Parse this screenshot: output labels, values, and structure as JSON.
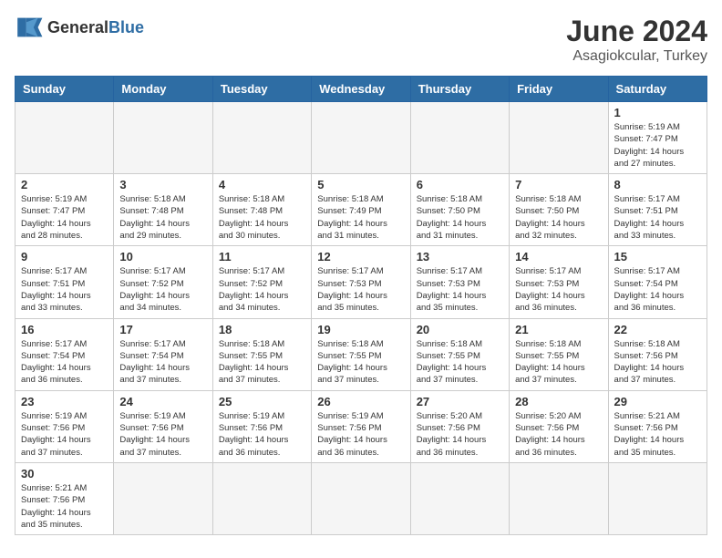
{
  "header": {
    "logo_general": "General",
    "logo_blue": "Blue",
    "month": "June 2024",
    "location": "Asagiokcular, Turkey"
  },
  "days_of_week": [
    "Sunday",
    "Monday",
    "Tuesday",
    "Wednesday",
    "Thursday",
    "Friday",
    "Saturday"
  ],
  "weeks": [
    [
      {
        "day": "",
        "info": ""
      },
      {
        "day": "",
        "info": ""
      },
      {
        "day": "",
        "info": ""
      },
      {
        "day": "",
        "info": ""
      },
      {
        "day": "",
        "info": ""
      },
      {
        "day": "",
        "info": ""
      },
      {
        "day": "1",
        "info": "Sunrise: 5:19 AM\nSunset: 7:47 PM\nDaylight: 14 hours\nand 27 minutes."
      }
    ],
    [
      {
        "day": "2",
        "info": "Sunrise: 5:19 AM\nSunset: 7:47 PM\nDaylight: 14 hours\nand 28 minutes."
      },
      {
        "day": "3",
        "info": "Sunrise: 5:18 AM\nSunset: 7:48 PM\nDaylight: 14 hours\nand 29 minutes."
      },
      {
        "day": "4",
        "info": "Sunrise: 5:18 AM\nSunset: 7:48 PM\nDaylight: 14 hours\nand 30 minutes."
      },
      {
        "day": "5",
        "info": "Sunrise: 5:18 AM\nSunset: 7:49 PM\nDaylight: 14 hours\nand 31 minutes."
      },
      {
        "day": "6",
        "info": "Sunrise: 5:18 AM\nSunset: 7:50 PM\nDaylight: 14 hours\nand 31 minutes."
      },
      {
        "day": "7",
        "info": "Sunrise: 5:18 AM\nSunset: 7:50 PM\nDaylight: 14 hours\nand 32 minutes."
      },
      {
        "day": "8",
        "info": "Sunrise: 5:17 AM\nSunset: 7:51 PM\nDaylight: 14 hours\nand 33 minutes."
      }
    ],
    [
      {
        "day": "9",
        "info": "Sunrise: 5:17 AM\nSunset: 7:51 PM\nDaylight: 14 hours\nand 33 minutes."
      },
      {
        "day": "10",
        "info": "Sunrise: 5:17 AM\nSunset: 7:52 PM\nDaylight: 14 hours\nand 34 minutes."
      },
      {
        "day": "11",
        "info": "Sunrise: 5:17 AM\nSunset: 7:52 PM\nDaylight: 14 hours\nand 34 minutes."
      },
      {
        "day": "12",
        "info": "Sunrise: 5:17 AM\nSunset: 7:53 PM\nDaylight: 14 hours\nand 35 minutes."
      },
      {
        "day": "13",
        "info": "Sunrise: 5:17 AM\nSunset: 7:53 PM\nDaylight: 14 hours\nand 35 minutes."
      },
      {
        "day": "14",
        "info": "Sunrise: 5:17 AM\nSunset: 7:53 PM\nDaylight: 14 hours\nand 36 minutes."
      },
      {
        "day": "15",
        "info": "Sunrise: 5:17 AM\nSunset: 7:54 PM\nDaylight: 14 hours\nand 36 minutes."
      }
    ],
    [
      {
        "day": "16",
        "info": "Sunrise: 5:17 AM\nSunset: 7:54 PM\nDaylight: 14 hours\nand 36 minutes."
      },
      {
        "day": "17",
        "info": "Sunrise: 5:17 AM\nSunset: 7:54 PM\nDaylight: 14 hours\nand 37 minutes."
      },
      {
        "day": "18",
        "info": "Sunrise: 5:18 AM\nSunset: 7:55 PM\nDaylight: 14 hours\nand 37 minutes."
      },
      {
        "day": "19",
        "info": "Sunrise: 5:18 AM\nSunset: 7:55 PM\nDaylight: 14 hours\nand 37 minutes."
      },
      {
        "day": "20",
        "info": "Sunrise: 5:18 AM\nSunset: 7:55 PM\nDaylight: 14 hours\nand 37 minutes."
      },
      {
        "day": "21",
        "info": "Sunrise: 5:18 AM\nSunset: 7:55 PM\nDaylight: 14 hours\nand 37 minutes."
      },
      {
        "day": "22",
        "info": "Sunrise: 5:18 AM\nSunset: 7:56 PM\nDaylight: 14 hours\nand 37 minutes."
      }
    ],
    [
      {
        "day": "23",
        "info": "Sunrise: 5:19 AM\nSunset: 7:56 PM\nDaylight: 14 hours\nand 37 minutes."
      },
      {
        "day": "24",
        "info": "Sunrise: 5:19 AM\nSunset: 7:56 PM\nDaylight: 14 hours\nand 37 minutes."
      },
      {
        "day": "25",
        "info": "Sunrise: 5:19 AM\nSunset: 7:56 PM\nDaylight: 14 hours\nand 36 minutes."
      },
      {
        "day": "26",
        "info": "Sunrise: 5:19 AM\nSunset: 7:56 PM\nDaylight: 14 hours\nand 36 minutes."
      },
      {
        "day": "27",
        "info": "Sunrise: 5:20 AM\nSunset: 7:56 PM\nDaylight: 14 hours\nand 36 minutes."
      },
      {
        "day": "28",
        "info": "Sunrise: 5:20 AM\nSunset: 7:56 PM\nDaylight: 14 hours\nand 36 minutes."
      },
      {
        "day": "29",
        "info": "Sunrise: 5:21 AM\nSunset: 7:56 PM\nDaylight: 14 hours\nand 35 minutes."
      }
    ],
    [
      {
        "day": "30",
        "info": "Sunrise: 5:21 AM\nSunset: 7:56 PM\nDaylight: 14 hours\nand 35 minutes."
      },
      {
        "day": "",
        "info": ""
      },
      {
        "day": "",
        "info": ""
      },
      {
        "day": "",
        "info": ""
      },
      {
        "day": "",
        "info": ""
      },
      {
        "day": "",
        "info": ""
      },
      {
        "day": "",
        "info": ""
      }
    ]
  ]
}
